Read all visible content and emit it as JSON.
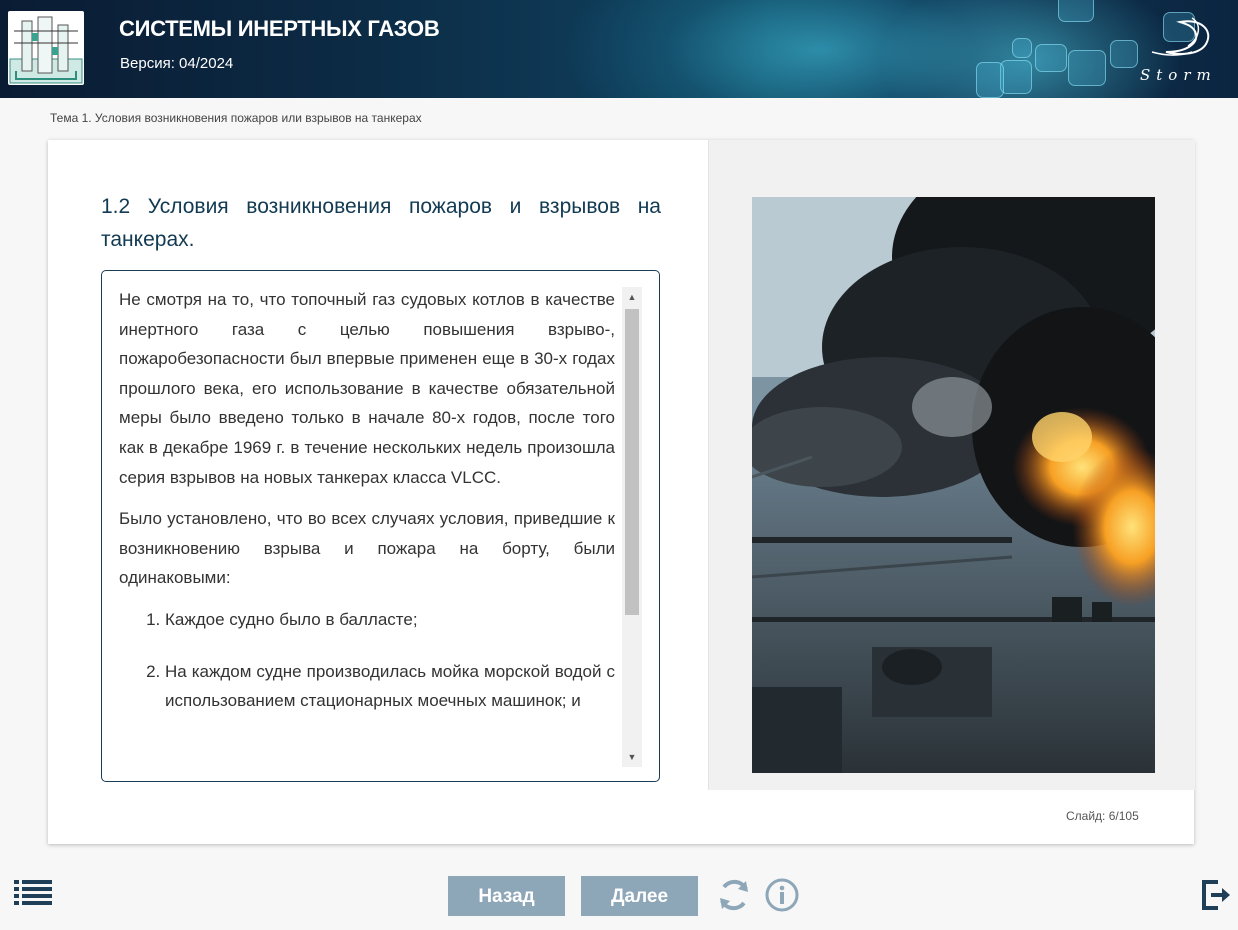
{
  "header": {
    "title": "СИСТЕМЫ ИНЕРТНЫХ ГАЗОВ",
    "version": "Версия: 04/2024",
    "brand": "Storm"
  },
  "breadcrumb": "Тема 1. Условия возникновения пожаров или взрывов на танкерах",
  "slide": {
    "heading": "1.2 Условия возникновения пожаров и взрывов на танкерах.",
    "paragraphs": [
      "Не смотря на то, что топочный газ судовых котлов в качестве инертного газа с целью повышения взрыво-, пожаробезопасности был впервые применен еще в 30-х годах прошлого века, его использование в качестве обязательной меры было введено только в начале 80-х годов, после того как в декабре 1969 г. в течение нескольких недель произошла серия взрывов на новых танкерах класса VLCC.",
      "Было установлено, что во всех случаях условия, приведшие к возникновению взрыва и пожара на борту, были одинаковыми:"
    ],
    "list": [
      "Каждое судно было в балласте;",
      "На каждом судне производилась мойка морской водой с использованием стационарных моечных машинок; и"
    ],
    "counter": "Слайд:  6/105"
  },
  "nav": {
    "back_label": "Назад",
    "next_label": "Далее"
  },
  "colors": {
    "button": "#8da6b8",
    "heading": "#123a52",
    "icon": "#1f3f58"
  },
  "icons": {
    "menu": "menu-list-icon",
    "reload": "reload-icon",
    "info": "info-icon",
    "exit": "exit-icon"
  }
}
